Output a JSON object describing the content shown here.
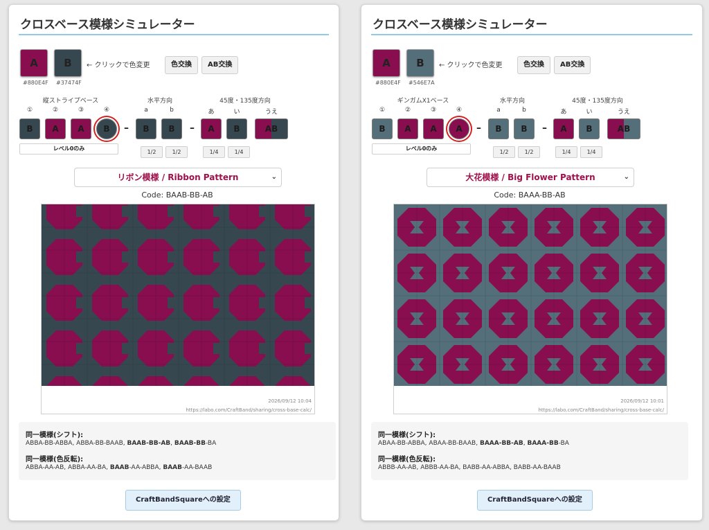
{
  "panels": [
    {
      "title": "クロスベース模様シミュレーター",
      "colorA": {
        "label": "A",
        "hex": "#880E4F"
      },
      "colorB": {
        "label": "B",
        "hex": "#37474F"
      },
      "hint": "← クリックで色変更",
      "swap_color_label": "色交換",
      "swap_ab_label": "AB交換",
      "base_label": "縦ストライプベース",
      "horizontal_label": "水平方向",
      "diagonal_label": "45度・135度方向",
      "numbers": [
        "①",
        "②",
        "③",
        "④"
      ],
      "base_cells": [
        "B",
        "A",
        "A",
        "B"
      ],
      "h_letters": [
        "a",
        "b"
      ],
      "h_cells": [
        "B",
        "B"
      ],
      "d_letters": [
        "あ",
        "い",
        "うえ"
      ],
      "d_cells": [
        "A",
        "B",
        "AB"
      ],
      "highlight_index": 3,
      "level_label": "レベル0のみ",
      "fractions": [
        "1/2",
        "1/2",
        "1/4",
        "1/4"
      ],
      "pattern_name": "リボン模様 / Ribbon Pattern",
      "code": "Code: BAAB-BB-AB",
      "timestamp": "2026/09/12 10:04",
      "url": "https://labo.com/CraftBand/sharing/cross-base-calc/",
      "same_shift_title": "同一模様(シフト):",
      "same_shift_parts": [
        "ABBA-BB-ABBA, ABBA-BB-BAAB, ",
        "BAAB-BB-AB",
        ", ",
        "BAAB-BB",
        "-BA"
      ],
      "same_invert_title": "同一模様(色反転):",
      "same_invert_parts": [
        "ABBA-AA-AB, ABBA-AA-BA, ",
        "BAAB",
        "-AA-ABBA, ",
        "BAAB",
        "-AA-BAAB"
      ],
      "config_button": "CraftBandSquareへの設定"
    },
    {
      "title": "クロスベース模様シミュレーター",
      "colorA": {
        "label": "A",
        "hex": "#880E4F"
      },
      "colorB": {
        "label": "B",
        "hex": "#546E7A"
      },
      "hint": "← クリックで色変更",
      "swap_color_label": "色交換",
      "swap_ab_label": "AB交換",
      "base_label": "ギンガムX1ベース",
      "horizontal_label": "水平方向",
      "diagonal_label": "45度・135度方向",
      "numbers": [
        "①",
        "②",
        "③",
        "④"
      ],
      "base_cells": [
        "B",
        "A",
        "A",
        "A"
      ],
      "h_letters": [
        "a",
        "b"
      ],
      "h_cells": [
        "B",
        "B"
      ],
      "d_letters": [
        "あ",
        "い",
        "うえ"
      ],
      "d_cells": [
        "A",
        "B",
        "AB"
      ],
      "highlight_index": 3,
      "level_label": "レベル0のみ",
      "fractions": [
        "1/2",
        "1/2",
        "1/4",
        "1/4"
      ],
      "pattern_name": "大花模様 / Big Flower Pattern",
      "code": "Code: BAAA-BB-AB",
      "timestamp": "2026/09/12 10:01",
      "url": "https://labo.com/CraftBand/sharing/cross-base-calc/",
      "same_shift_title": "同一模様(シフト):",
      "same_shift_parts": [
        "ABAA-BB-ABBA, ABAA-BB-BAAB, ",
        "BAAA-BB-AB",
        ", ",
        "BAAA-BB",
        "-BA"
      ],
      "same_invert_title": "同一模様(色反転):",
      "same_invert_parts": [
        "ABBB-AA-AB, ABBB-AA-BA, BABB-AA-ABBA, BABB-AA-BAAB",
        "",
        "",
        "",
        ""
      ],
      "config_button": "CraftBandSquareへの設定"
    }
  ]
}
